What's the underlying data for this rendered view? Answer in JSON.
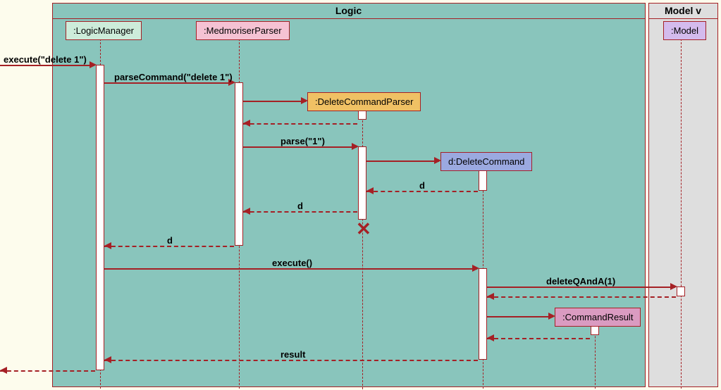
{
  "frames": {
    "logic": {
      "label": "Logic",
      "bg": "#89c5bc",
      "labelBg": "#89c5bc"
    },
    "model": {
      "label": "Model v",
      "bg": "#dedede",
      "labelBg": "#dedede"
    }
  },
  "lifelines": {
    "logicManager": {
      "label": ":LogicManager",
      "bg": "#cdecda"
    },
    "medmoriserParser": {
      "label": ":MedmoriserParser",
      "bg": "#f5c2d3"
    },
    "deleteCommandParser": {
      "label": ":DeleteCommandParser",
      "bg": "#f0c164"
    },
    "deleteCommand": {
      "label": "d:DeleteCommand",
      "bg": "#9ba9e0"
    },
    "commandResult": {
      "label": ":CommandResult",
      "bg": "#da9bc1"
    },
    "model": {
      "label": ":Model",
      "bg": "#d4bbed"
    }
  },
  "messages": {
    "executeDelete": "execute(\"delete 1\")",
    "parseCommand": "parseCommand(\"delete 1\")",
    "parse": "parse(\"1\")",
    "d1": "d",
    "d2": "d",
    "d3": "d",
    "execute": "execute()",
    "deleteQAndA": "deleteQAndA(1)",
    "result": "result"
  }
}
